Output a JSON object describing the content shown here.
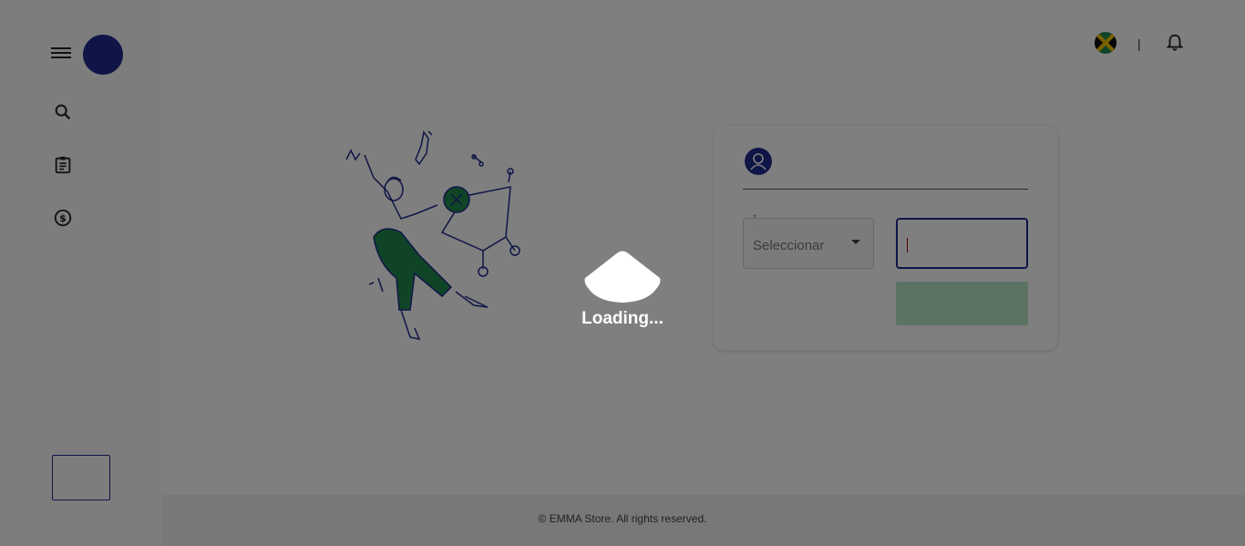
{
  "colors": {
    "brand_navy": "#1f2b8f",
    "brand_green": "#1f8a4c",
    "overlay": "rgba(0,0,0,0.5)"
  },
  "sidebar": {
    "menu_icon": "hamburger-menu-icon",
    "items": [
      {
        "icon": "search-icon"
      },
      {
        "icon": "clipboard-icon"
      },
      {
        "icon": "dollar-circle-icon"
      }
    ]
  },
  "header": {
    "language_flag": "jamaica-flag-icon",
    "separator": "|",
    "notification_icon": "bell-icon"
  },
  "login_card": {
    "user_icon": "user-icon",
    "select": {
      "required_mark": "*",
      "value": "Seleccionar"
    },
    "input": {
      "value": ""
    }
  },
  "loading": {
    "text": "Loading..."
  },
  "footer": {
    "text": "© EMMA Store. All rights reserved."
  }
}
